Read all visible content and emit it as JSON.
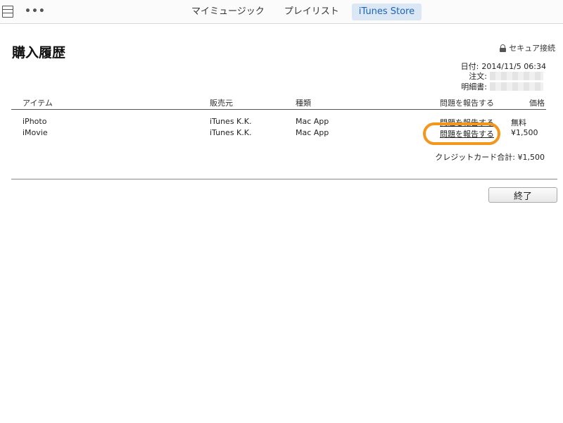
{
  "nav": {
    "tabs": [
      {
        "label": "マイミュージック",
        "active": false
      },
      {
        "label": "プレイリスト",
        "active": false
      },
      {
        "label": "iTunes Store",
        "active": true
      }
    ]
  },
  "page": {
    "title": "購入履歴",
    "secure_label": "セキュア接続"
  },
  "meta": {
    "date_label": "日付:",
    "date_value": "2014/11/5 06:34",
    "order_label": "注文:",
    "receipt_label": "明細書:"
  },
  "table": {
    "headers": {
      "item": "アイテム",
      "seller": "販売元",
      "kind": "種類",
      "report": "問題を報告する",
      "price": "価格"
    },
    "rows": [
      {
        "item": "iPhoto",
        "seller": "iTunes K.K.",
        "kind": "Mac App",
        "report": "問題を報告する",
        "price": "無料"
      },
      {
        "item": "iMovie",
        "seller": "iTunes K.K.",
        "kind": "Mac App",
        "report": "問題を報告する",
        "price": "¥1,500"
      }
    ]
  },
  "total": {
    "label": "クレジットカード合計:",
    "value": "¥1,500"
  },
  "footer": {
    "done_label": "終了"
  },
  "colors": {
    "accent": "#1b64b5",
    "active_tab_bg": "#dbe7f4",
    "highlight": "#f3961c"
  }
}
